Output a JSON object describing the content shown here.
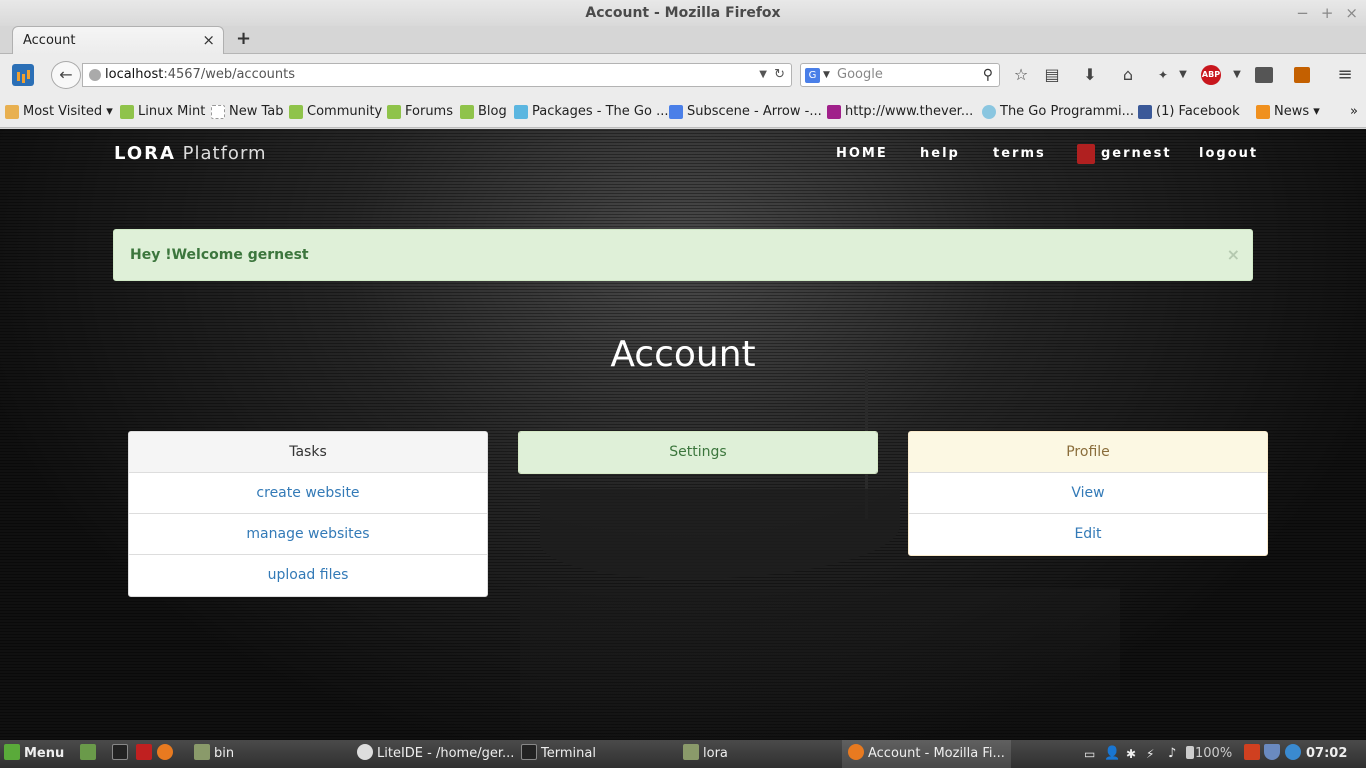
{
  "window": {
    "title": "Account - Mozilla Firefox",
    "controls": [
      "−",
      "+",
      "×"
    ]
  },
  "tab": {
    "label": "Account",
    "close": "×",
    "new_tab": "+"
  },
  "nav": {
    "back": "←",
    "url_host": "localhost",
    "url_path": ":4567/web/accounts",
    "search_placeholder": "Google",
    "search_engine": "G"
  },
  "bookmarks": [
    {
      "label": "Most Visited ▾",
      "color": "#e8b050"
    },
    {
      "label": "Linux Mint",
      "color": "#8fc34a"
    },
    {
      "label": "New Tab",
      "color": "#ffffff"
    },
    {
      "label": "Community",
      "color": "#8fc34a"
    },
    {
      "label": "Forums",
      "color": "#8fc34a"
    },
    {
      "label": "Blog",
      "color": "#8fc34a"
    },
    {
      "label": "Packages - The Go ...",
      "color": "#5bb6e0"
    },
    {
      "label": "Subscene - Arrow -...",
      "color": "#4a7fe8"
    },
    {
      "label": "http://www.thever...",
      "color": "#a0208a"
    },
    {
      "label": "The Go Programmi...",
      "color": "#8ac6e0"
    },
    {
      "label": "(1) Facebook",
      "color": "#3b5998"
    },
    {
      "label": "News ▾",
      "color": "#f0901e"
    }
  ],
  "site": {
    "brand_strong": "LORA",
    "brand_light": "Platform",
    "nav": [
      "HOME",
      "help",
      "terms",
      "gernest",
      "logout"
    ],
    "alert": "Hey !Welcome gernest",
    "alert_close": "×",
    "title": "Account"
  },
  "cards": [
    {
      "header": "Tasks",
      "header_bg": "#f5f5f5",
      "header_color": "#333333",
      "items": [
        "create website",
        "manage websites",
        "upload files"
      ]
    },
    {
      "header": "Settings",
      "header_bg": "#dff0d8",
      "header_color": "#3c763d",
      "items": []
    },
    {
      "header": "Profile",
      "header_bg": "#fcf8e3",
      "header_color": "#8a6d3b",
      "items": [
        "View",
        "Edit"
      ]
    }
  ],
  "taskbar": {
    "menu": "Menu",
    "items": [
      "bin",
      "LiteIDE - /home/ger...",
      "Terminal",
      "lora",
      "Account - Mozilla Fi..."
    ],
    "battery": "100%",
    "clock": "07:02"
  }
}
